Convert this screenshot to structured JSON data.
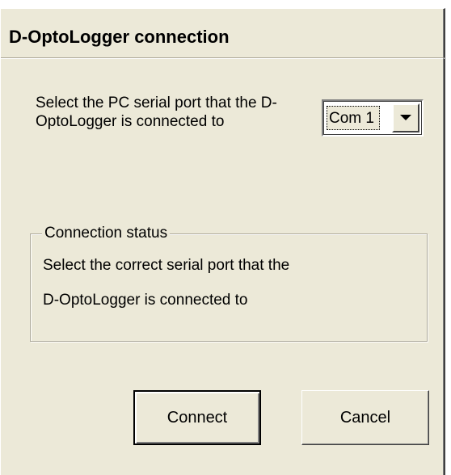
{
  "window": {
    "title": "D-OptoLogger connection"
  },
  "port_selection": {
    "prompt": "Select the PC serial port that the D-OptoLogger is connected to",
    "selected_port": "Com 1"
  },
  "status_group": {
    "legend": "Connection status",
    "message_line1": "Select the correct serial port that the",
    "message_line2": "D-OptoLogger is connected to"
  },
  "buttons": {
    "connect_label": "Connect",
    "cancel_label": "Cancel"
  },
  "icons": {
    "dropdown": "chevron-down-icon"
  },
  "colors": {
    "dialog_face": "#ece9d8",
    "highlight": "#ffffff",
    "shadow": "#808080",
    "dark_shadow": "#404040",
    "text": "#000000"
  }
}
